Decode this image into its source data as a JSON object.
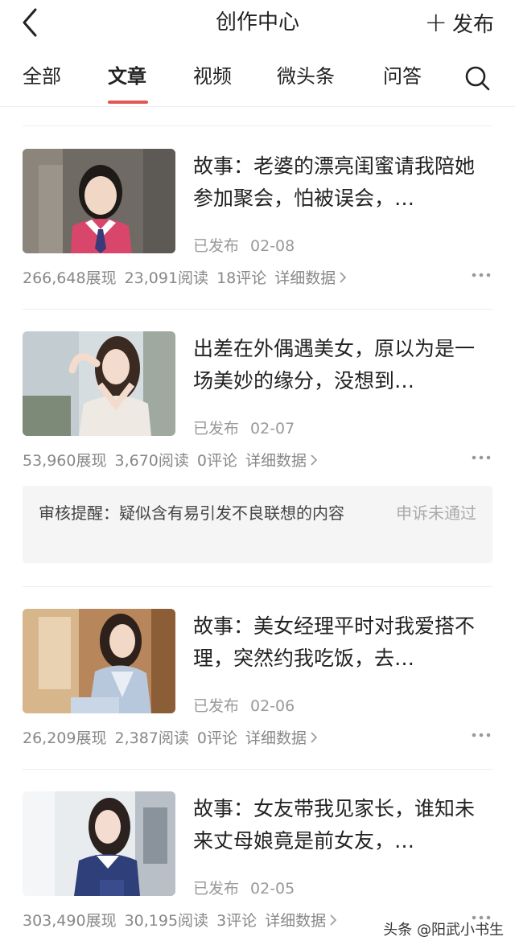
{
  "header": {
    "title": "创作中心",
    "publish_label": "发布"
  },
  "tabs": [
    {
      "label": "全部",
      "active": false
    },
    {
      "label": "文章",
      "active": true
    },
    {
      "label": "视频",
      "active": false
    },
    {
      "label": "微头条",
      "active": false
    },
    {
      "label": "问答",
      "active": false
    }
  ],
  "articles": [
    {
      "title": "故事：老婆的漂亮闺蜜请我陪她参加聚会，怕被误会，…",
      "status": "已发布",
      "date": "02-08",
      "impressions": "266,648展现",
      "reads": "23,091阅读",
      "comments": "18评论",
      "detail_label": "详细数据"
    },
    {
      "title": "出差在外偶遇美女，原以为是一场美妙的缘分，没想到…",
      "status": "已发布",
      "date": "02-07",
      "impressions": "53,960展现",
      "reads": "3,670阅读",
      "comments": "0评论",
      "detail_label": "详细数据"
    },
    {
      "title": "故事：美女经理平时对我爱搭不理，突然约我吃饭，去…",
      "status": "已发布",
      "date": "02-06",
      "impressions": "26,209展现",
      "reads": "2,387阅读",
      "comments": "0评论",
      "detail_label": "详细数据"
    },
    {
      "title": "故事：女友带我见家长，谁知未来丈母娘竟是前女友，…",
      "status": "已发布",
      "date": "02-05",
      "impressions": "303,490展现",
      "reads": "30,195阅读",
      "comments": "3评论",
      "detail_label": "详细数据"
    }
  ],
  "review_notice": {
    "text": "审核提醒：疑似含有易引发不良联想的内容",
    "appeal_status": "申诉未通过"
  },
  "watermark": "头条 @阳武小书生",
  "colors": {
    "accent": "#e35654",
    "muted_text": "#999999",
    "notice_bg": "#f5f5f5"
  }
}
